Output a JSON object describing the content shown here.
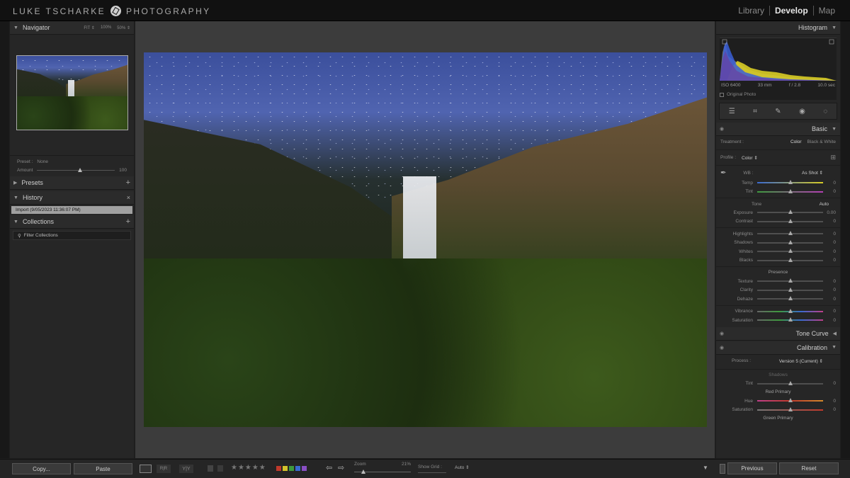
{
  "brand": {
    "left": "LUKE TSCHARKE",
    "right": "PHOTOGRAPHY"
  },
  "modules": [
    "Library",
    "Develop",
    "Map"
  ],
  "navigator": {
    "title": "Navigator",
    "zoom_options": [
      "FIT ⇕",
      "100%",
      "50% ⇕"
    ]
  },
  "preset": {
    "label": "Preset :",
    "value": "None",
    "amount_label": "Amount",
    "amount_value": "100"
  },
  "presets": {
    "title": "Presets"
  },
  "history": {
    "title": "History",
    "items": [
      "Import (9/05/2023 11:36:07 PM)"
    ]
  },
  "collections": {
    "title": "Collections",
    "filter": "Filter Collections"
  },
  "left_buttons": {
    "copy": "Copy...",
    "paste": "Paste"
  },
  "histogram": {
    "title": "Histogram",
    "iso": "ISO 6400",
    "focal": "33 mm",
    "aperture": "f / 2.8",
    "shutter": "10.0 sec",
    "original": "Original Photo"
  },
  "basic": {
    "title": "Basic",
    "treatment_label": "Treatment :",
    "treatment_color": "Color",
    "treatment_bw": "Black & White",
    "profile_label": "Profile :",
    "profile_value": "Color ⇕",
    "wb_label": "WB :",
    "wb_value": "As Shot ⇕",
    "temp": {
      "label": "Temp",
      "value": "0"
    },
    "tint": {
      "label": "Tint",
      "value": "0"
    },
    "tone_label": "Tone",
    "auto": "Auto",
    "exposure": {
      "label": "Exposure",
      "value": "0.00"
    },
    "contrast": {
      "label": "Contrast",
      "value": "0"
    },
    "highlights": {
      "label": "Highlights",
      "value": "0"
    },
    "shadows": {
      "label": "Shadows",
      "value": "0"
    },
    "whites": {
      "label": "Whites",
      "value": "0"
    },
    "blacks": {
      "label": "Blacks",
      "value": "0"
    },
    "presence_label": "Presence",
    "texture": {
      "label": "Texture",
      "value": "0"
    },
    "clarity": {
      "label": "Clarity",
      "value": "0"
    },
    "dehaze": {
      "label": "Dehaze",
      "value": "0"
    },
    "vibrance": {
      "label": "Vibrance",
      "value": "0"
    },
    "saturation": {
      "label": "Saturation",
      "value": "0"
    }
  },
  "tone_curve": {
    "title": "Tone Curve"
  },
  "calibration": {
    "title": "Calibration",
    "process_label": "Process :",
    "process_value": "Version 5 (Current) ⇕",
    "shadows_label": "Shadows",
    "shadow_tint": {
      "label": "Tint",
      "value": "0"
    },
    "red_primary": "Red Primary",
    "red_hue": {
      "label": "Hue",
      "value": "0"
    },
    "red_sat": {
      "label": "Saturation",
      "value": "0"
    },
    "green_primary": "Green Primary"
  },
  "right_buttons": {
    "previous": "Previous",
    "reset": "Reset"
  },
  "toolbar": {
    "zoom_label": "Zoom",
    "zoom_value": "21%",
    "grid_label": "Show Grid :",
    "grid_value": "Auto ⇕"
  },
  "colors": {
    "accent": "#e6e6e6",
    "panel": "#262626",
    "red_label": "#c0392b",
    "yellow_label": "#d4c22b",
    "green_label": "#3e9a3e",
    "blue_label": "#3a6ad0",
    "purple_label": "#8a4fc4"
  }
}
